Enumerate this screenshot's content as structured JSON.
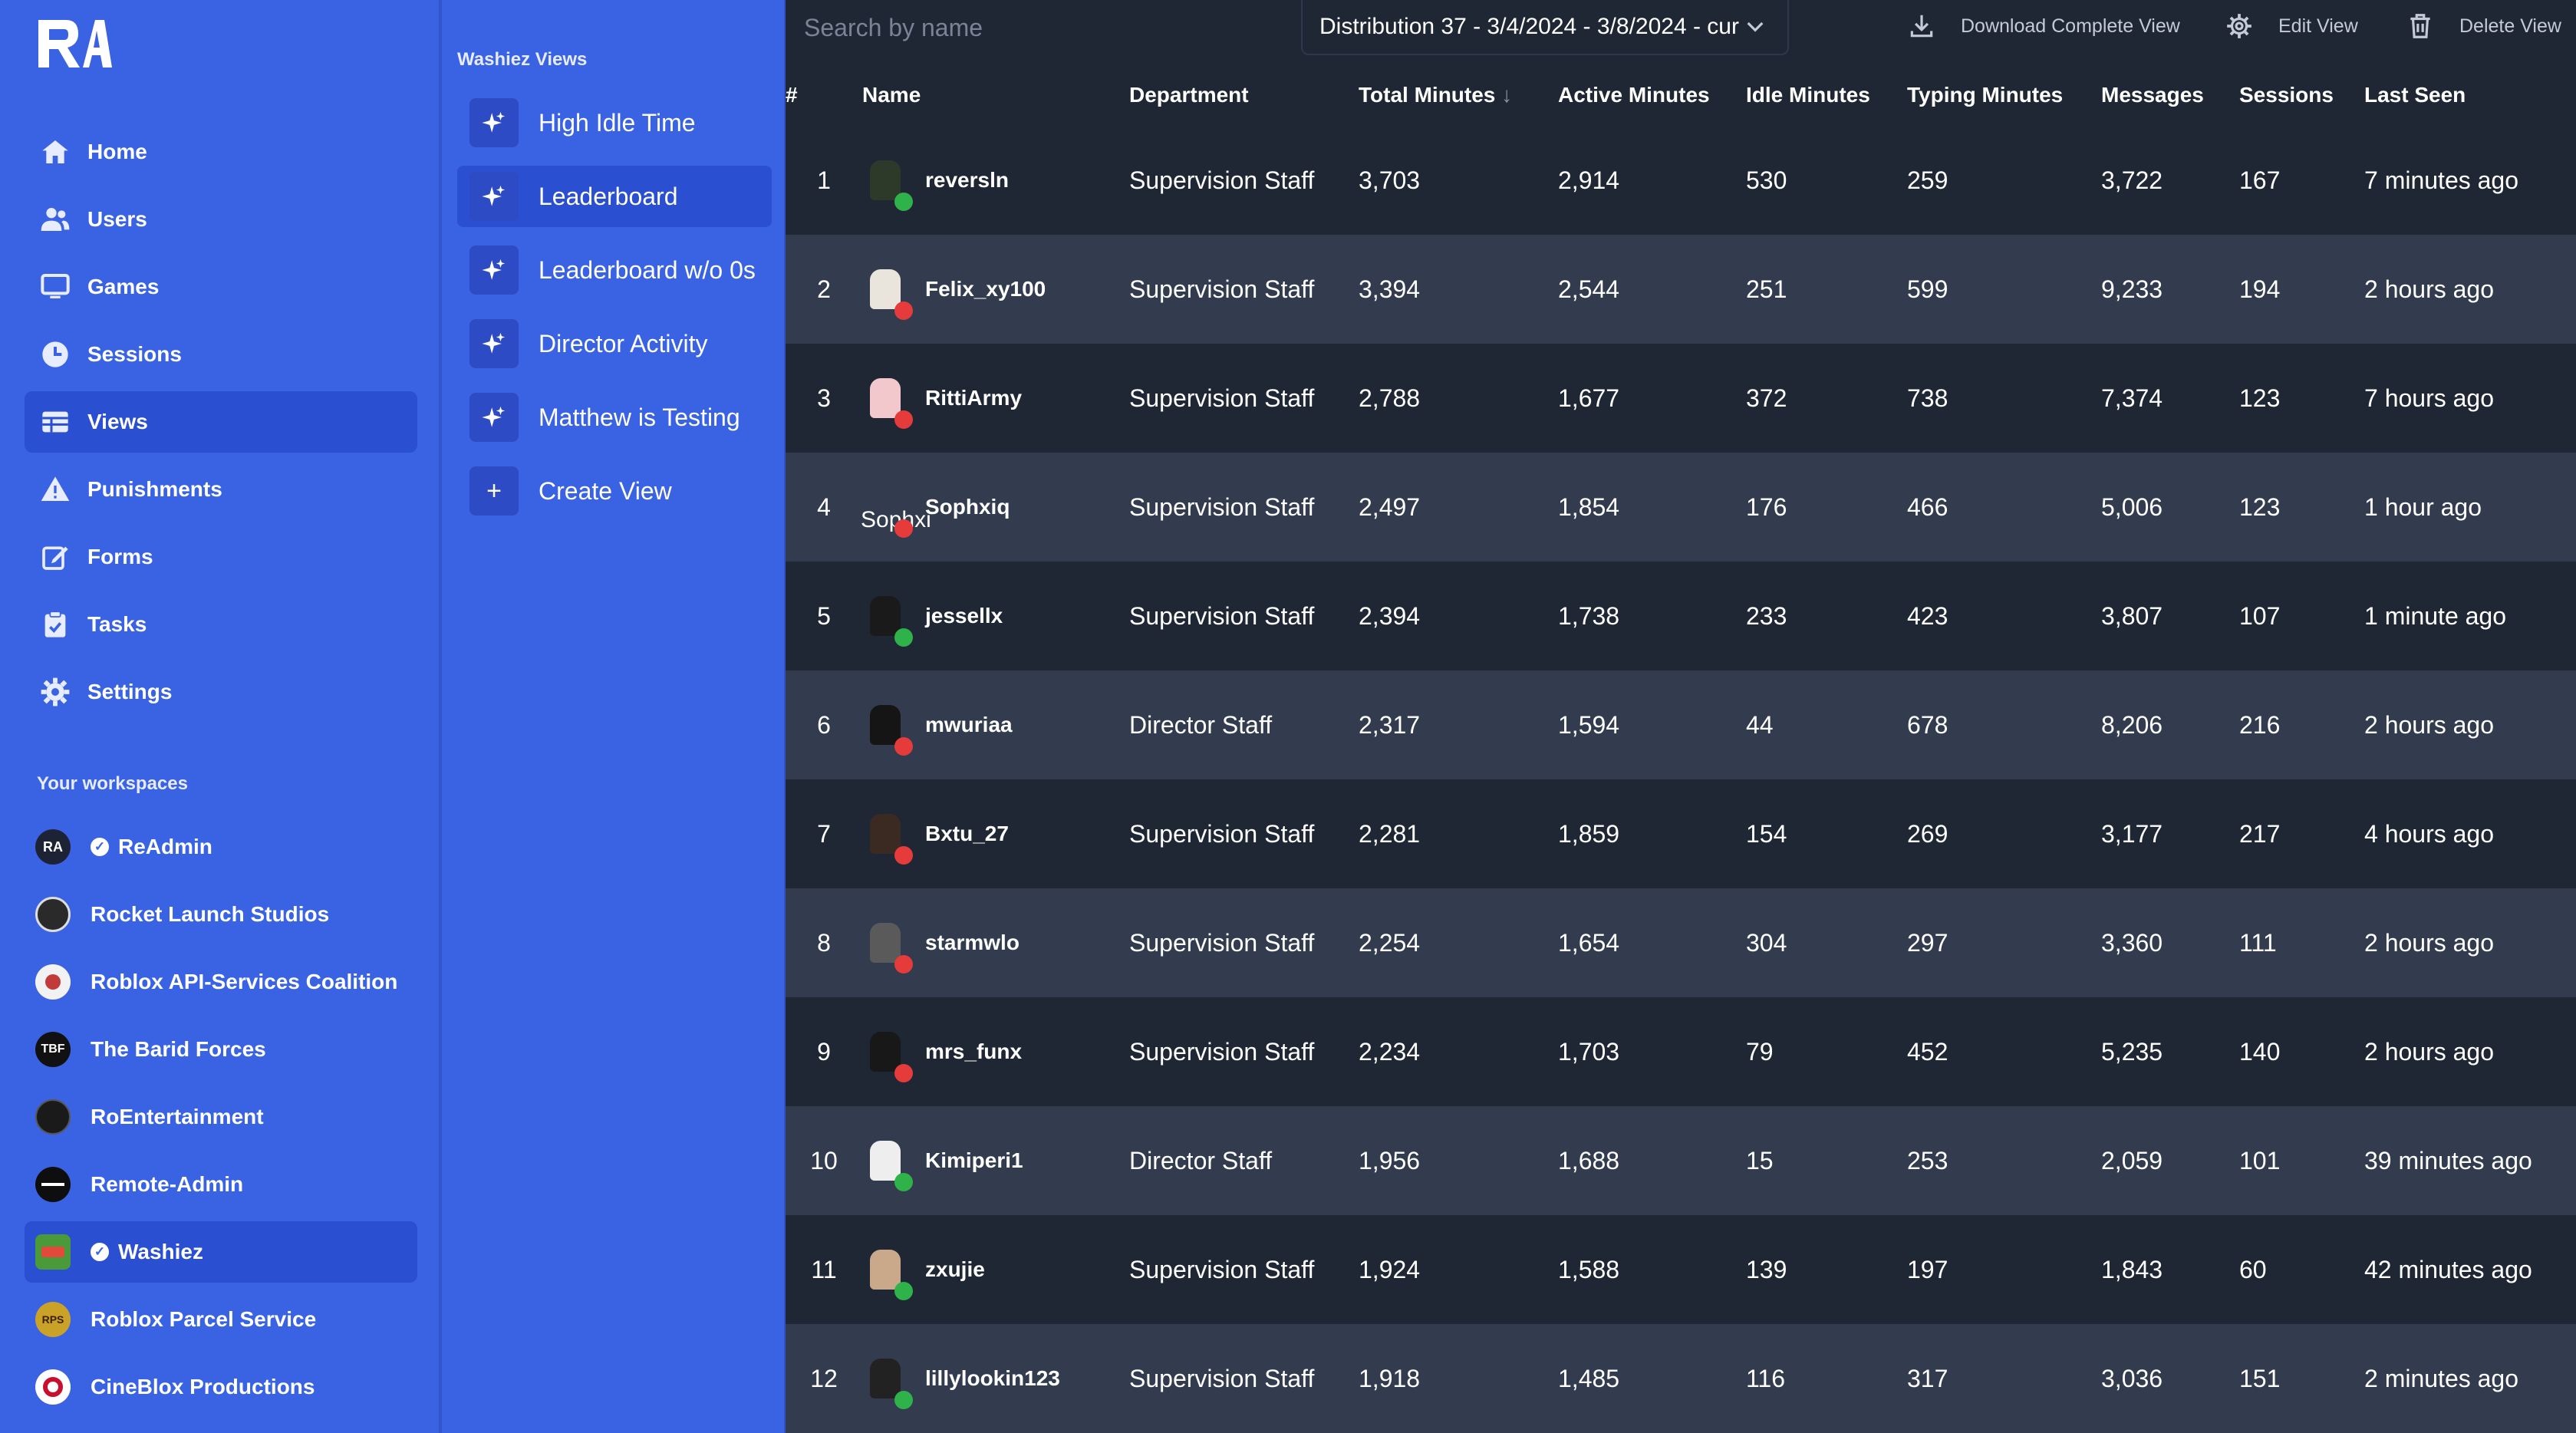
{
  "nav": {
    "items": [
      {
        "label": "Home",
        "icon": "home-icon"
      },
      {
        "label": "Users",
        "icon": "users-icon"
      },
      {
        "label": "Games",
        "icon": "monitor-icon"
      },
      {
        "label": "Sessions",
        "icon": "clock-icon"
      },
      {
        "label": "Views",
        "icon": "table-icon",
        "active": true
      },
      {
        "label": "Punishments",
        "icon": "warning-icon"
      },
      {
        "label": "Forms",
        "icon": "edit-icon"
      },
      {
        "label": "Tasks",
        "icon": "clipboard-check-icon"
      },
      {
        "label": "Settings",
        "icon": "gear-icon"
      }
    ]
  },
  "workspaces": {
    "heading": "Your workspaces",
    "items": [
      {
        "label": "ReAdmin",
        "verified": true,
        "avatar_color": "#1e2235",
        "avatar_text": "RA"
      },
      {
        "label": "Rocket Launch Studios",
        "verified": false,
        "avatar_color": "#2a2a2a",
        "avatar_text": ""
      },
      {
        "label": "Roblox API-Services Coalition",
        "verified": false,
        "avatar_color": "#f2f2f2",
        "avatar_text": ""
      },
      {
        "label": "The Barid Forces",
        "verified": false,
        "avatar_color": "#111111",
        "avatar_text": "TBF"
      },
      {
        "label": "RoEntertainment",
        "verified": false,
        "avatar_color": "#1a1a1a",
        "avatar_text": ""
      },
      {
        "label": "Remote-Admin",
        "verified": false,
        "avatar_color": "#0e0e0e",
        "avatar_text": ""
      },
      {
        "label": "Washiez",
        "verified": true,
        "active": true,
        "avatar_color": "#4a9a3a",
        "avatar_text": ""
      },
      {
        "label": "Roblox Parcel Service",
        "verified": false,
        "avatar_color": "#c9a227",
        "avatar_text": "RPS"
      },
      {
        "label": "CineBlox Productions",
        "verified": false,
        "avatar_color": "#ffffff",
        "avatar_text": ""
      }
    ]
  },
  "views": {
    "heading": "Washiez Views",
    "items": [
      {
        "label": "High Idle Time",
        "icon": "sparkles-icon"
      },
      {
        "label": "Leaderboard",
        "icon": "sparkles-icon",
        "active": true
      },
      {
        "label": "Leaderboard w/o 0s",
        "icon": "sparkles-icon"
      },
      {
        "label": "Director Activity",
        "icon": "sparkles-icon"
      },
      {
        "label": "Matthew is Testing",
        "icon": "sparkles-icon"
      },
      {
        "label": "Create View",
        "icon": "plus-icon"
      }
    ]
  },
  "toolbar": {
    "search_placeholder": "Search by name",
    "distribution": "Distribution 37 - 3/4/2024 - 3/8/2024 - cur",
    "download": "Download Complete View",
    "edit": "Edit View",
    "delete": "Delete View"
  },
  "table": {
    "headers": [
      "#",
      "Name",
      "Department",
      "Total Minutes",
      "Active Minutes",
      "Idle Minutes",
      "Typing Minutes",
      "Messages",
      "Sessions",
      "Last Seen"
    ],
    "sort_indicator": "↓",
    "colors": {
      "online": "#2fb24a",
      "offline": "#e53b3b"
    },
    "rows": [
      {
        "rank": "1",
        "name": "reversln",
        "dept": "Supervision Staff",
        "total": "3,703",
        "active": "2,914",
        "idle": "530",
        "typing": "259",
        "messages": "3,722",
        "sessions": "167",
        "last": "7 minutes ago",
        "online": true,
        "avatar": "#2d3a2a"
      },
      {
        "rank": "2",
        "name": "Felix_xy100",
        "dept": "Supervision Staff",
        "total": "3,394",
        "active": "2,544",
        "idle": "251",
        "typing": "599",
        "messages": "9,233",
        "sessions": "194",
        "last": "2 hours ago",
        "online": false,
        "avatar": "#e9e4dc"
      },
      {
        "rank": "3",
        "name": "RittiArmy",
        "dept": "Supervision Staff",
        "total": "2,788",
        "active": "1,677",
        "idle": "372",
        "typing": "738",
        "messages": "7,374",
        "sessions": "123",
        "last": "7 hours ago",
        "online": false,
        "avatar": "#f2c8cc"
      },
      {
        "rank": "4",
        "name": "Sophxiq",
        "dept": "Supervision Staff",
        "total": "2,497",
        "active": "1,854",
        "idle": "176",
        "typing": "466",
        "messages": "5,006",
        "sessions": "123",
        "last": "1 hour ago",
        "online": false,
        "avatar": "#3a4558",
        "avatar_label": "Sophxi"
      },
      {
        "rank": "5",
        "name": "jessellx",
        "dept": "Supervision Staff",
        "total": "2,394",
        "active": "1,738",
        "idle": "233",
        "typing": "423",
        "messages": "3,807",
        "sessions": "107",
        "last": "1 minute ago",
        "online": true,
        "avatar": "#1a1a1a"
      },
      {
        "rank": "6",
        "name": "mwuriaa",
        "dept": "Director Staff",
        "total": "2,317",
        "active": "1,594",
        "idle": "44",
        "typing": "678",
        "messages": "8,206",
        "sessions": "216",
        "last": "2 hours ago",
        "online": false,
        "avatar": "#151515"
      },
      {
        "rank": "7",
        "name": "Bxtu_27",
        "dept": "Supervision Staff",
        "total": "2,281",
        "active": "1,859",
        "idle": "154",
        "typing": "269",
        "messages": "3,177",
        "sessions": "217",
        "last": "4 hours ago",
        "online": false,
        "avatar": "#3b2a22"
      },
      {
        "rank": "8",
        "name": "starmwlo",
        "dept": "Supervision Staff",
        "total": "2,254",
        "active": "1,654",
        "idle": "304",
        "typing": "297",
        "messages": "3,360",
        "sessions": "111",
        "last": "2 hours ago",
        "online": false,
        "avatar": "#5a5a5a"
      },
      {
        "rank": "9",
        "name": "mrs_funx",
        "dept": "Supervision Staff",
        "total": "2,234",
        "active": "1,703",
        "idle": "79",
        "typing": "452",
        "messages": "5,235",
        "sessions": "140",
        "last": "2 hours ago",
        "online": false,
        "avatar": "#181818"
      },
      {
        "rank": "10",
        "name": "Kimiperi1",
        "dept": "Director Staff",
        "total": "1,956",
        "active": "1,688",
        "idle": "15",
        "typing": "253",
        "messages": "2,059",
        "sessions": "101",
        "last": "39 minutes ago",
        "online": true,
        "avatar": "#eeeeee"
      },
      {
        "rank": "11",
        "name": "zxujie",
        "dept": "Supervision Staff",
        "total": "1,924",
        "active": "1,588",
        "idle": "139",
        "typing": "197",
        "messages": "1,843",
        "sessions": "60",
        "last": "42 minutes ago",
        "online": true,
        "avatar": "#c9a98a"
      },
      {
        "rank": "12",
        "name": "lillylookin123",
        "dept": "Supervision Staff",
        "total": "1,918",
        "active": "1,485",
        "idle": "116",
        "typing": "317",
        "messages": "3,036",
        "sessions": "151",
        "last": "2 minutes ago",
        "online": true,
        "avatar": "#222222"
      }
    ]
  }
}
